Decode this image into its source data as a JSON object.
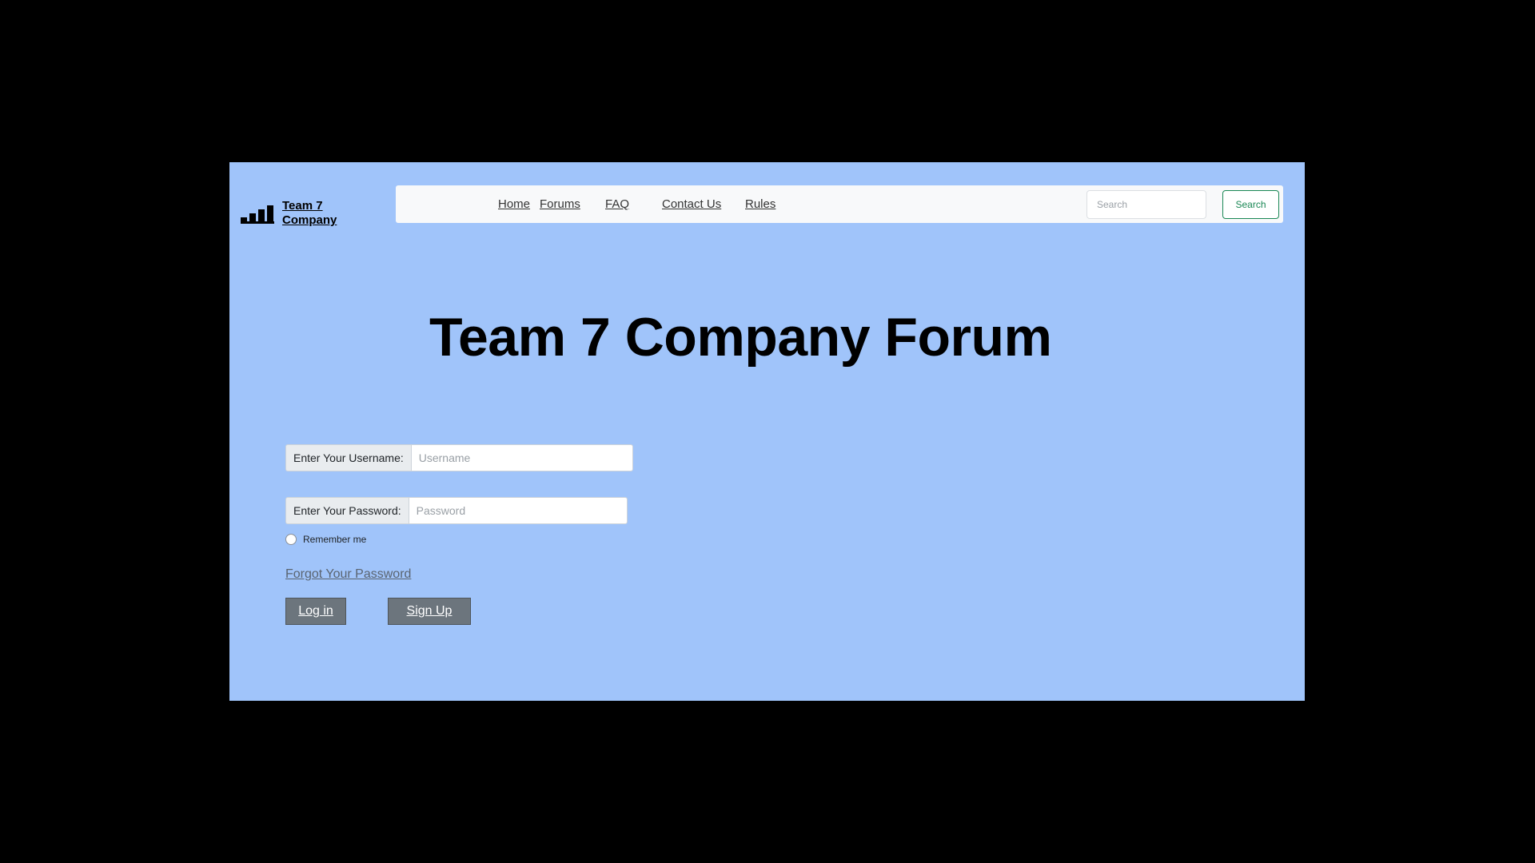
{
  "brand": {
    "name": "Team 7 Company",
    "icon": "bar-chart-icon"
  },
  "nav": {
    "items": [
      "Home",
      "Forums",
      "FAQ",
      "Contact Us",
      "Rules"
    ]
  },
  "search": {
    "placeholder": "Search",
    "button_label": "Search",
    "accent_color": "#198754"
  },
  "main": {
    "title": "Team 7 Company Forum"
  },
  "login_form": {
    "username_label": "Enter Your Username:",
    "username_placeholder": "Username",
    "username_value": "",
    "password_label": "Enter Your Password:",
    "password_placeholder": "Password",
    "password_value": "",
    "remember_label": "Remember me",
    "remember_checked": false,
    "forgot_link": "Forgot Your Password",
    "login_button": "Log in",
    "signup_button": "Sign Up"
  },
  "colors": {
    "page_background": "#a0c4fa",
    "navbar_background": "#f8f9fa",
    "button_background": "#6c757d"
  }
}
